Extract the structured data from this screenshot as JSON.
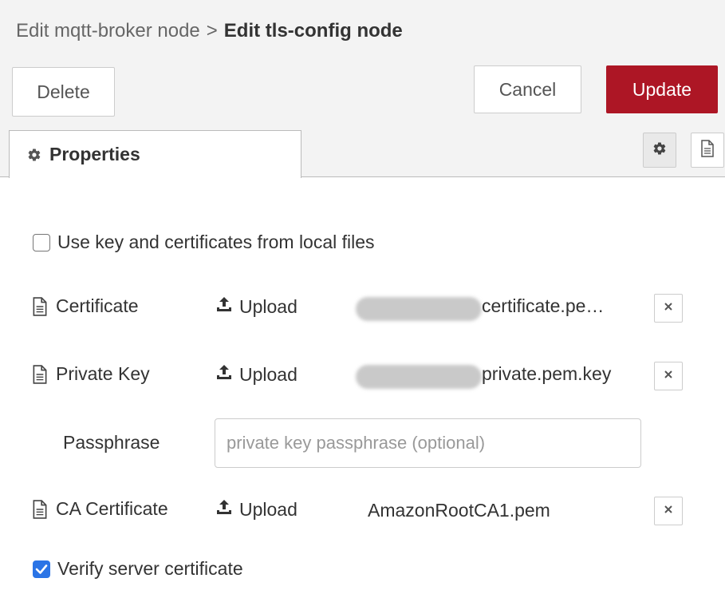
{
  "breadcrumb": {
    "parent": "Edit mqtt-broker node",
    "separator": ">",
    "current": "Edit tls-config node"
  },
  "toolbar": {
    "delete_label": "Delete",
    "cancel_label": "Cancel",
    "update_label": "Update"
  },
  "tabs": {
    "properties_label": "Properties"
  },
  "form": {
    "local_files": {
      "label": "Use key and certificates from local files",
      "checked": false
    },
    "certificate": {
      "label": "Certificate",
      "upload_label": "Upload",
      "filename": "certificate.pe…"
    },
    "private_key": {
      "label": "Private Key",
      "upload_label": "Upload",
      "filename": "private.pem.key"
    },
    "passphrase": {
      "label": "Passphrase",
      "value": "",
      "placeholder": "private key passphrase (optional)"
    },
    "ca_certificate": {
      "label": "CA Certificate",
      "upload_label": "Upload",
      "filename": "AmazonRootCA1.pem"
    },
    "verify_server": {
      "label": "Verify server certificate",
      "checked": true
    }
  },
  "icons": {
    "gear": "gear-icon",
    "file": "file-icon",
    "upload": "upload-icon",
    "close": "close-icon"
  },
  "colors": {
    "update_button": "#ad1625",
    "checkbox_checked": "#2a74e6",
    "toolbar_background": "#f3f3f3"
  }
}
